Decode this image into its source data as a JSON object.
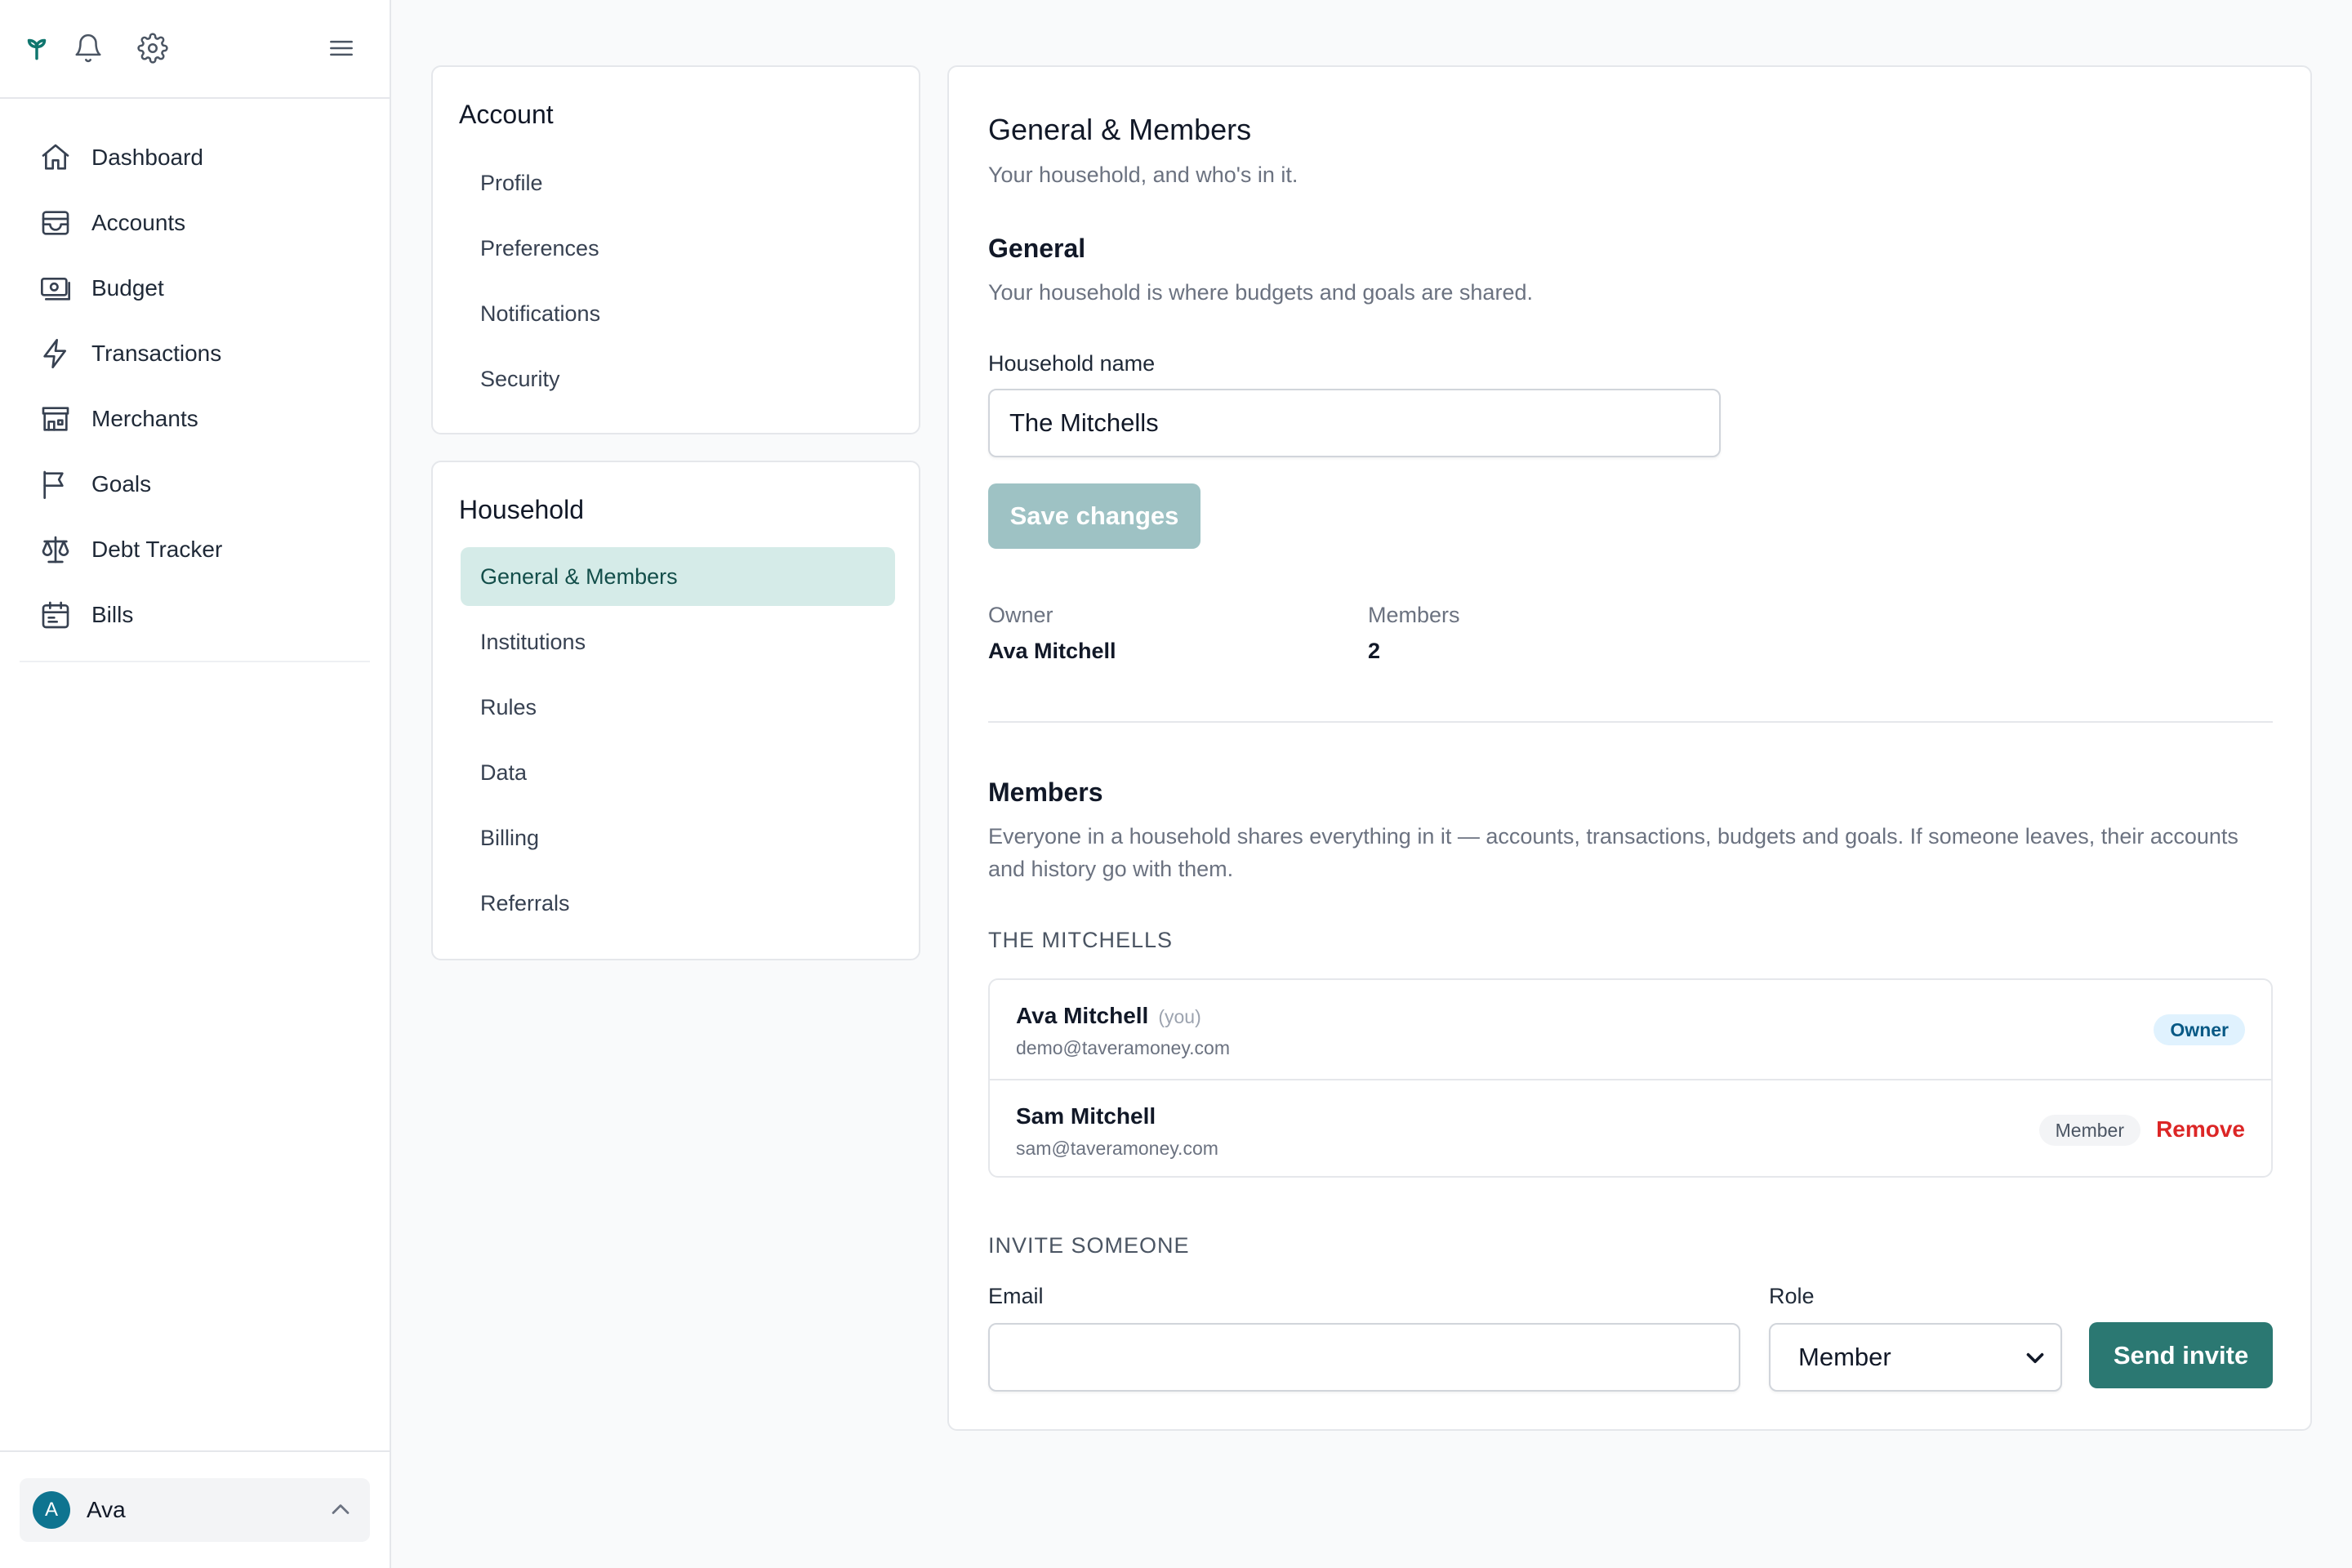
{
  "sidebar": {
    "nav": [
      {
        "label": "Dashboard",
        "icon": "home-icon"
      },
      {
        "label": "Accounts",
        "icon": "wallet-icon"
      },
      {
        "label": "Budget",
        "icon": "banknote-icon"
      },
      {
        "label": "Transactions",
        "icon": "lightning-icon"
      },
      {
        "label": "Merchants",
        "icon": "store-icon"
      },
      {
        "label": "Goals",
        "icon": "flag-icon"
      },
      {
        "label": "Debt Tracker",
        "icon": "scale-icon"
      },
      {
        "label": "Bills",
        "icon": "calendar-icon"
      }
    ],
    "user": {
      "initial": "A",
      "name": "Ava"
    }
  },
  "settings_nav": {
    "account": {
      "title": "Account",
      "items": [
        "Profile",
        "Preferences",
        "Notifications",
        "Security"
      ]
    },
    "household": {
      "title": "Household",
      "items": [
        "General & Members",
        "Institutions",
        "Rules",
        "Data",
        "Billing",
        "Referrals"
      ],
      "active": "General & Members"
    }
  },
  "main": {
    "title": "General & Members",
    "subtitle": "Your household, and who's in it.",
    "general": {
      "heading": "General",
      "description": "Your household is where budgets and goals are shared.",
      "name_label": "Household name",
      "name_value": "The Mitchells",
      "save_label": "Save changes"
    },
    "meta": {
      "owner_label": "Owner",
      "owner_value": "Ava Mitchell",
      "members_label": "Members",
      "members_value": "2"
    },
    "members": {
      "heading": "Members",
      "description": "Everyone in a household shares everything in it — accounts, transactions, budgets and goals. If someone leaves, their accounts and history go with them.",
      "group_label": "THE MITCHELLS",
      "list": [
        {
          "name": "Ava Mitchell",
          "you": "(you)",
          "email": "demo@taveramoney.com",
          "role": "Owner"
        },
        {
          "name": "Sam Mitchell",
          "email": "sam@taveramoney.com",
          "role": "Member",
          "action": "Remove"
        }
      ]
    },
    "invite": {
      "heading": "INVITE SOMEONE",
      "email_label": "Email",
      "email_value": "",
      "email_placeholder": "",
      "role_label": "Role",
      "role_value": "Member",
      "send_label": "Send invite"
    }
  },
  "colors": {
    "brand": "#2b7872",
    "active_nav_bg": "#d5ebe8",
    "danger": "#dc2626",
    "owner_badge_bg": "#e0f2fe",
    "avatar_bg": "#0e7490"
  }
}
